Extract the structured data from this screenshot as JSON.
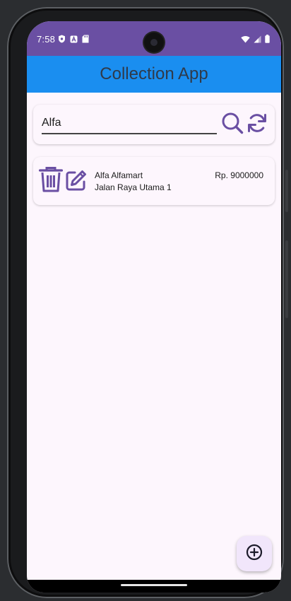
{
  "status_bar": {
    "time": "7:58",
    "left_icons": [
      "shield-icon",
      "a-badge-icon",
      "sd-card-icon"
    ],
    "right_icons": [
      "wifi-icon",
      "signal-icon",
      "battery-icon"
    ],
    "color": "#6a4fa3"
  },
  "app_bar": {
    "title": "Collection App",
    "color": "#1a8ef0"
  },
  "search": {
    "value": "Alfa",
    "search_icon": "magnify-icon",
    "refresh_icon": "refresh-icon"
  },
  "items": [
    {
      "name": "Alfa Alfamart",
      "address": "Jalan Raya Utama 1",
      "amount": "Rp. 9000000",
      "delete_icon": "trash-icon",
      "edit_icon": "edit-icon"
    }
  ],
  "fab": {
    "icon": "plus-circle-icon"
  },
  "colors": {
    "accent": "#6a4fa3",
    "background": "#fdf6fd",
    "fab_background": "#f1e6fb"
  }
}
